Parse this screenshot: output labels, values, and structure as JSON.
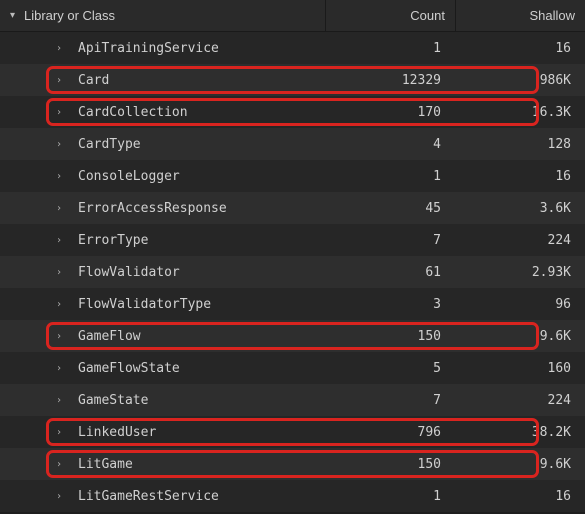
{
  "header": {
    "name_label": "Library or Class",
    "count_label": "Count",
    "shallow_label": "Shallow"
  },
  "rows": [
    {
      "name": "ApiTrainingService",
      "count": "1",
      "shallow": "16",
      "highlight": false
    },
    {
      "name": "Card",
      "count": "12329",
      "shallow": "986K",
      "highlight": true
    },
    {
      "name": "CardCollection",
      "count": "170",
      "shallow": "16.3K",
      "highlight": true
    },
    {
      "name": "CardType",
      "count": "4",
      "shallow": "128",
      "highlight": false
    },
    {
      "name": "ConsoleLogger",
      "count": "1",
      "shallow": "16",
      "highlight": false
    },
    {
      "name": "ErrorAccessResponse",
      "count": "45",
      "shallow": "3.6K",
      "highlight": false
    },
    {
      "name": "ErrorType",
      "count": "7",
      "shallow": "224",
      "highlight": false
    },
    {
      "name": "FlowValidator",
      "count": "61",
      "shallow": "2.93K",
      "highlight": false
    },
    {
      "name": "FlowValidatorType",
      "count": "3",
      "shallow": "96",
      "highlight": false
    },
    {
      "name": "GameFlow",
      "count": "150",
      "shallow": "9.6K",
      "highlight": true
    },
    {
      "name": "GameFlowState",
      "count": "5",
      "shallow": "160",
      "highlight": false
    },
    {
      "name": "GameState",
      "count": "7",
      "shallow": "224",
      "highlight": false
    },
    {
      "name": "LinkedUser",
      "count": "796",
      "shallow": "38.2K",
      "highlight": true
    },
    {
      "name": "LitGame",
      "count": "150",
      "shallow": "9.6K",
      "highlight": true
    },
    {
      "name": "LitGameRestService",
      "count": "1",
      "shallow": "16",
      "highlight": false
    }
  ]
}
